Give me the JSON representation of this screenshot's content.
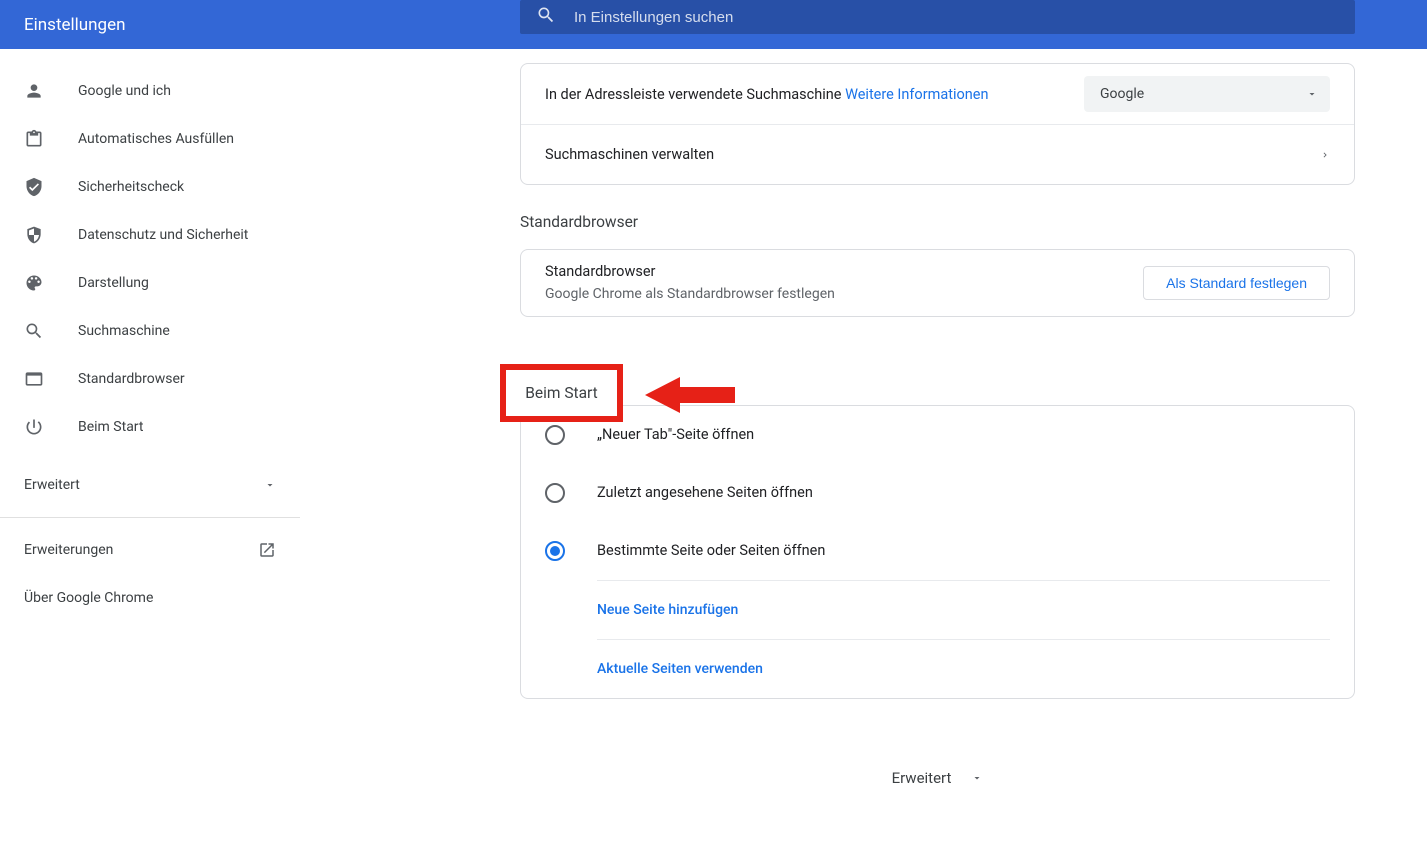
{
  "header": {
    "title": "Einstellungen",
    "search_placeholder": "In Einstellungen suchen"
  },
  "sidebar": {
    "items": [
      {
        "label": "Google und ich"
      },
      {
        "label": "Automatisches Ausfüllen"
      },
      {
        "label": "Sicherheitscheck"
      },
      {
        "label": "Datenschutz und Sicherheit"
      },
      {
        "label": "Darstellung"
      },
      {
        "label": "Suchmaschine"
      },
      {
        "label": "Standardbrowser"
      },
      {
        "label": "Beim Start"
      }
    ],
    "advanced_label": "Erweitert",
    "extensions_label": "Erweiterungen",
    "about_label": "Über Google Chrome"
  },
  "main": {
    "search_engine": {
      "row_text": "In der Adressleiste verwendete Suchmaschine",
      "learn_more": "Weitere Informationen",
      "selected_engine": "Google",
      "manage_label": "Suchmaschinen verwalten"
    },
    "default_browser_section_title": "Standardbrowser",
    "default_browser": {
      "title": "Standardbrowser",
      "subtitle": "Google Chrome als Standardbrowser festlegen",
      "button": "Als Standard festlegen"
    },
    "startup_section_title": "Beim Start",
    "startup": {
      "opt1": "„Neuer Tab\"-Seite öffnen",
      "opt2": "Zuletzt angesehene Seiten öffnen",
      "opt3": "Bestimmte Seite oder Seiten öffnen",
      "add_page": "Neue Seite hinzufügen",
      "use_current": "Aktuelle Seiten verwenden"
    },
    "bottom_advanced": "Erweitert"
  }
}
